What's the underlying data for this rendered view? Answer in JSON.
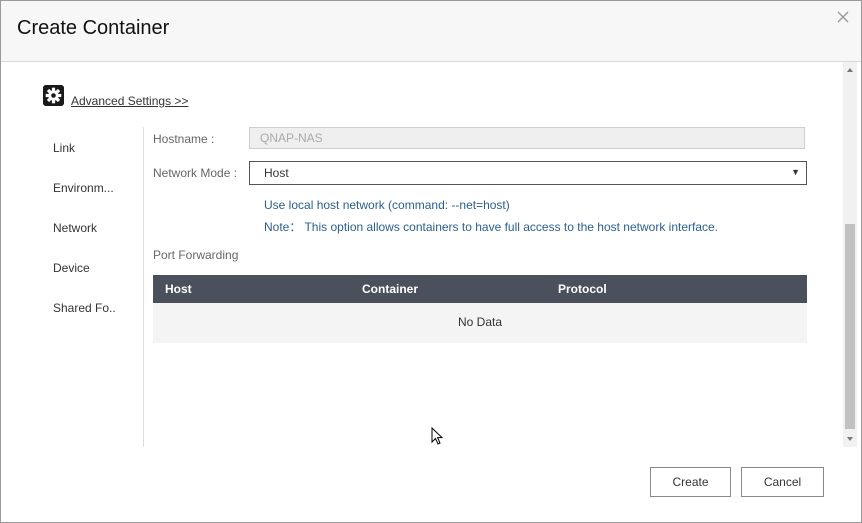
{
  "dialog": {
    "title": "Create Container"
  },
  "advanced": {
    "link_label": "Advanced Settings >>"
  },
  "sidebar": {
    "items": [
      {
        "label": "Link"
      },
      {
        "label": "Environm..."
      },
      {
        "label": "Network"
      },
      {
        "label": "Device"
      },
      {
        "label": "Shared Fo.."
      }
    ],
    "active": "Network"
  },
  "network": {
    "hostname_label": "Hostname :",
    "hostname_value": "QNAP-NAS",
    "mode_label": "Network Mode :",
    "mode_value": "Host",
    "info_line1": "Use local host network (command: --net=host)",
    "info_line2": "Note： This option allows containers to have full access to the host network interface.",
    "port_forwarding_label": "Port Forwarding"
  },
  "port_table": {
    "columns": [
      "Host",
      "Container",
      "Protocol"
    ],
    "empty_text": "No Data"
  },
  "footer": {
    "create_label": "Create",
    "cancel_label": "Cancel"
  }
}
